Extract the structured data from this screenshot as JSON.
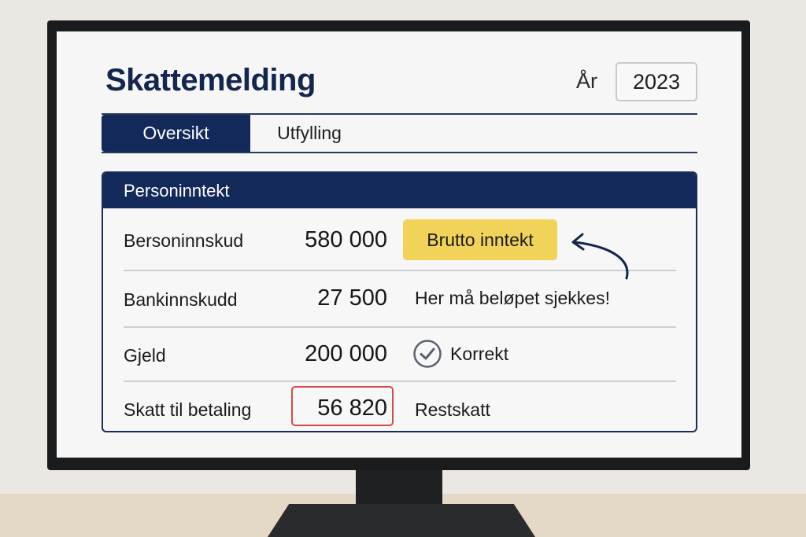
{
  "header": {
    "title": "Skattemelding",
    "year_label": "År",
    "year_value": "2023"
  },
  "tabs": [
    {
      "label": "Oversikt",
      "active": true
    },
    {
      "label": "Utfylling",
      "active": false
    }
  ],
  "card": {
    "title": "Personinntekt",
    "rows": [
      {
        "label": "Bersoninnskud",
        "value": "580 000",
        "note": "Brutto inntekt",
        "note_style": "badge"
      },
      {
        "label": "Bankinnskudd",
        "value": "27 500",
        "note": "Her må beløpet sjekkes!",
        "note_style": "text"
      },
      {
        "label": "Gjeld",
        "value": "200 000",
        "note": "Korrekt",
        "note_style": "check"
      },
      {
        "label": "Skatt til betaling",
        "value": "56 820",
        "note": "Restskatt",
        "note_style": "text"
      }
    ]
  },
  "icons": {
    "check": "check-circle-icon",
    "arrow": "curved-arrow-icon"
  },
  "colors": {
    "navy": "#13295a",
    "badge_yellow": "#f2d35a",
    "alert_red": "#d54a4a"
  }
}
